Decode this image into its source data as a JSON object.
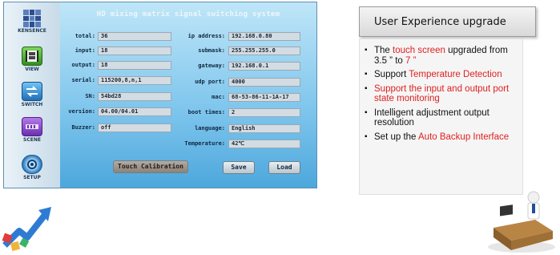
{
  "app": {
    "title": "HD mixing matrix signal switching system",
    "brand": "KENSENCE"
  },
  "sidebar": {
    "items": [
      {
        "label": "VIEW",
        "icon": "film-icon"
      },
      {
        "label": "SWITCH",
        "icon": "switch-icon"
      },
      {
        "label": "SCENE",
        "icon": "scene-icon"
      },
      {
        "label": "SETUP",
        "icon": "gear-icon"
      }
    ]
  },
  "info_left": [
    {
      "label": "total:",
      "value": "36"
    },
    {
      "label": "input:",
      "value": "18"
    },
    {
      "label": "output:",
      "value": "18"
    },
    {
      "label": "serial:",
      "value": "115200,8,n,1"
    },
    {
      "label": "SN:",
      "value": "54bd28"
    },
    {
      "label": "version:",
      "value": "04.00/04.01"
    },
    {
      "label": "Buzzer:",
      "value": "off"
    }
  ],
  "info_right": [
    {
      "label": "ip address:",
      "value": "192.168.0.80"
    },
    {
      "label": "submask:",
      "value": "255.255.255.0"
    },
    {
      "label": "gateway:",
      "value": "192.168.0.1"
    },
    {
      "label": "udp port:",
      "value": "4000"
    },
    {
      "label": "mac:",
      "value": "68-53-86-11-1A-17"
    },
    {
      "label": "boot times:",
      "value": "2"
    },
    {
      "label": "language:",
      "value": "English"
    },
    {
      "label": "Temperature:",
      "value": "42℃"
    }
  ],
  "buttons": {
    "calibration": "Touch Calibration",
    "save": "Save",
    "load": "Load"
  },
  "card": {
    "heading": "User Experience upgrade",
    "b1_pre": "The ",
    "b1_red1": "touch screen",
    "b1_mid": " upgraded from 3.5 ”  to ",
    "b1_red2": "7 ”",
    "b2_pre": "Support ",
    "b2_red": "Temperature Detection",
    "b3_red": "Support the input and output port state monitoring",
    "b4": "Intelligent adjustment output resolution",
    "b5_pre": "Set up the ",
    "b5_red": "Auto Backup Interface"
  },
  "colors": {
    "accent_red": "#e02020",
    "screen_blue": "#4aa9de",
    "field_bg": "#d3dce3"
  }
}
